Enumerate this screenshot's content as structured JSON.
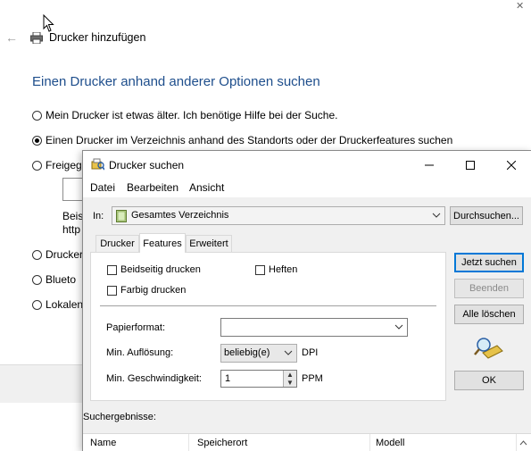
{
  "wizard": {
    "title": "Drucker hinzufügen",
    "heading": "Einen Drucker anhand anderer Optionen suchen",
    "options": [
      {
        "label": "Mein Drucker ist etwas älter. Ich benötige Hilfe bei der Suche.",
        "selected": false
      },
      {
        "label": "Einen Drucker im Verzeichnis anhand des Standorts oder der Druckerfeatures suchen",
        "selected": true
      },
      {
        "label": "Freigeg",
        "selected": false
      },
      {
        "label": "Drucker",
        "selected": false
      },
      {
        "label": "Blueto",
        "selected": false
      },
      {
        "label": "Lokalen",
        "selected": false
      }
    ],
    "partial_text_1": "Beis",
    "partial_text_2": "http"
  },
  "dialog": {
    "title": "Drucker suchen",
    "menu": [
      "Datei",
      "Bearbeiten",
      "Ansicht"
    ],
    "in_label": "In:",
    "location": "Gesamtes Verzeichnis",
    "browse_button": "Durchsuchen...",
    "tabs": [
      "Drucker",
      "Features",
      "Erweitert"
    ],
    "active_tab": "Features",
    "features": {
      "duplex_label": "Beidseitig drucken",
      "duplex_checked": false,
      "staple_label": "Heften",
      "staple_checked": false,
      "color_label": "Farbig drucken",
      "color_checked": false,
      "paper_label": "Papierformat:",
      "paper_value": "",
      "resolution_label": "Min. Auflösung:",
      "resolution_value": "beliebig(e)",
      "resolution_unit": "DPI",
      "speed_label": "Min. Geschwindigkeit:",
      "speed_value": "1",
      "speed_unit": "PPM"
    },
    "buttons": {
      "search_now": "Jetzt suchen",
      "stop": "Beenden",
      "clear_all": "Alle löschen",
      "ok": "OK"
    },
    "results_label": "Suchergebnisse:",
    "columns": [
      "Name",
      "Speicherort",
      "Modell"
    ]
  }
}
